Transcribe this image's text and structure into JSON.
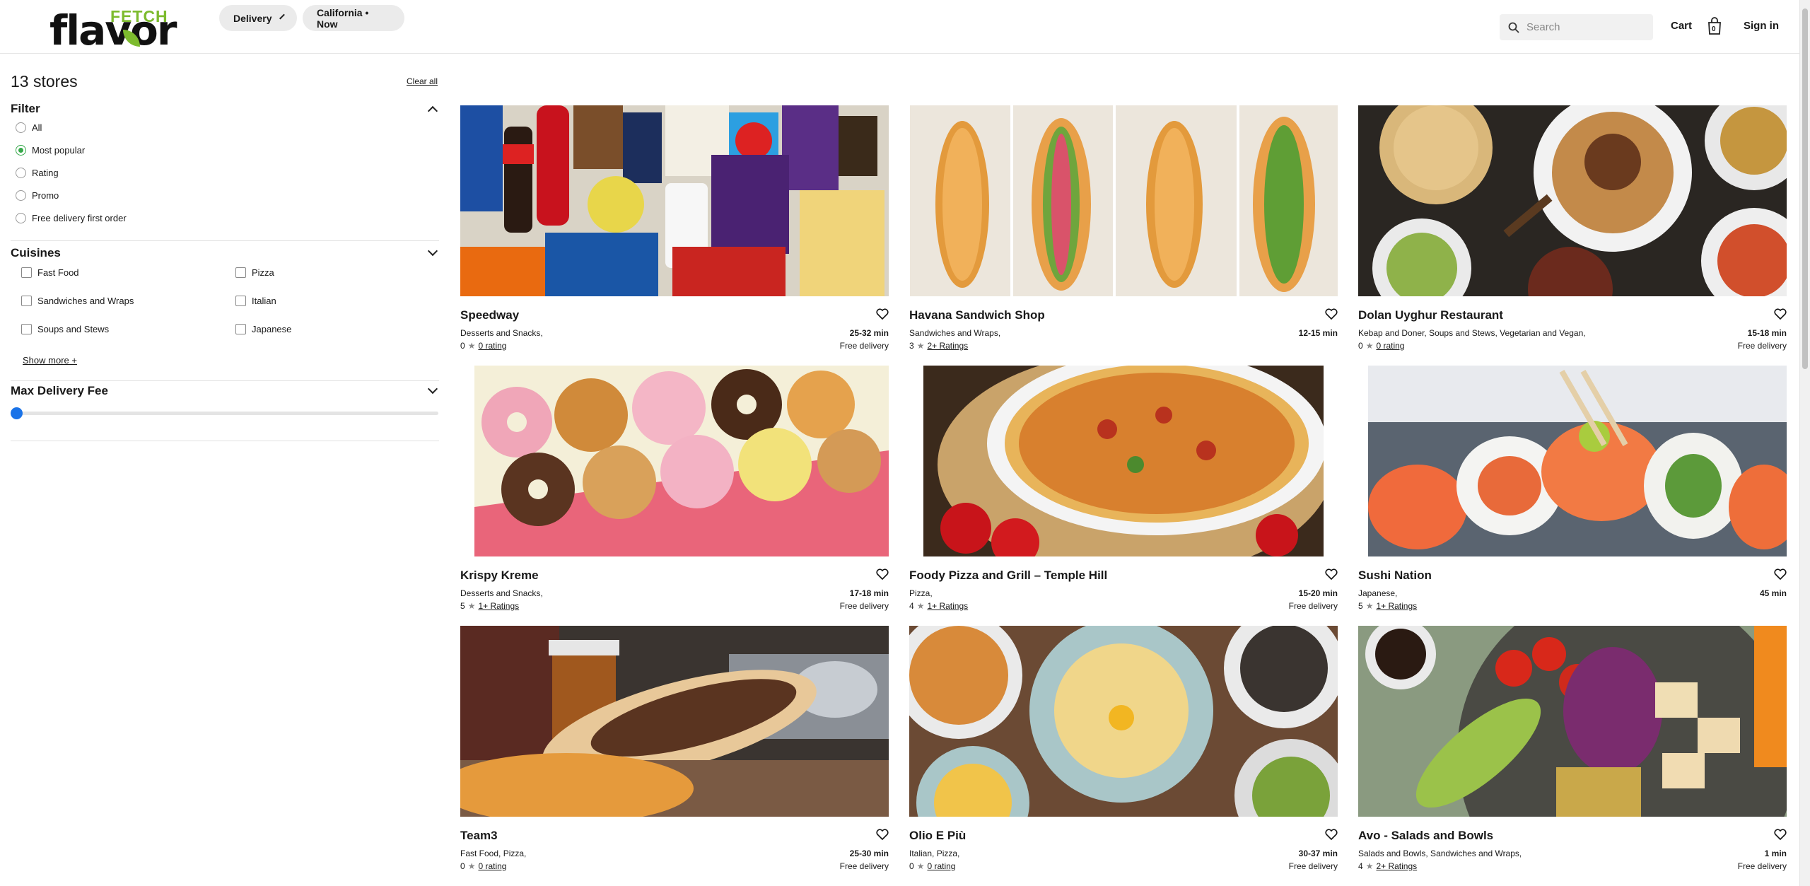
{
  "header": {
    "logo_top": "FETCH",
    "logo_main": "flavor",
    "delivery_mode": "Delivery",
    "location": "California • Now",
    "search_placeholder": "Search",
    "cart_label": "Cart",
    "cart_count": "0",
    "signin_label": "Sign in"
  },
  "sidebar": {
    "stores_count": "13 stores",
    "clear_all": "Clear all",
    "filter_title": "Filter",
    "filters": [
      "All",
      "Most popular",
      "Rating",
      "Promo",
      "Free delivery first order"
    ],
    "selected_filter": "Most popular",
    "cuisines_title": "Cuisines",
    "cuisines": [
      "Fast Food",
      "Pizza",
      "Sandwiches and Wraps",
      "Italian",
      "Soups and Stews",
      "Japanese"
    ],
    "show_more": "Show more +",
    "max_fee_title": "Max Delivery Fee",
    "max_fee_value": 0
  },
  "stores": [
    {
      "name": "Speedway",
      "cuisine": "Desserts and Snacks,",
      "time": "25-32 min",
      "rating": "0",
      "rating_link": "0 rating",
      "fee": "Free delivery"
    },
    {
      "name": "Havana Sandwich Shop",
      "cuisine": "Sandwiches and Wraps,",
      "time": "12-15 min",
      "rating": "3",
      "rating_link": "2+ Ratings",
      "fee": ""
    },
    {
      "name": "Dolan Uyghur Restaurant",
      "cuisine": "Kebap and Doner, Soups and Stews, Vegetarian and Vegan,",
      "time": "15-18 min",
      "rating": "0",
      "rating_link": "0 rating",
      "fee": "Free delivery"
    },
    {
      "name": "Krispy Kreme",
      "cuisine": "Desserts and Snacks,",
      "time": "17-18 min",
      "rating": "5",
      "rating_link": "1+ Ratings",
      "fee": "Free delivery"
    },
    {
      "name": "Foody Pizza and Grill – Temple Hill",
      "cuisine": "Pizza,",
      "time": "15-20 min",
      "rating": "4",
      "rating_link": "1+ Ratings",
      "fee": "Free delivery"
    },
    {
      "name": "Sushi Nation",
      "cuisine": "Japanese,",
      "time": "45 min",
      "rating": "5",
      "rating_link": "1+ Ratings",
      "fee": ""
    },
    {
      "name": "Team3",
      "cuisine": "Fast Food, Pizza,",
      "time": "25-30 min",
      "rating": "0",
      "rating_link": "0 rating",
      "fee": "Free delivery"
    },
    {
      "name": "Olio E Più",
      "cuisine": "Italian, Pizza,",
      "time": "30-37 min",
      "rating": "0",
      "rating_link": "0 rating",
      "fee": "Free delivery"
    },
    {
      "name": "Avo - Salads and Bowls",
      "cuisine": "Salads and Bowls, Sandwiches and Wraps,",
      "time": "1 min",
      "rating": "4",
      "rating_link": "2+ Ratings",
      "fee": "Free delivery"
    }
  ]
}
